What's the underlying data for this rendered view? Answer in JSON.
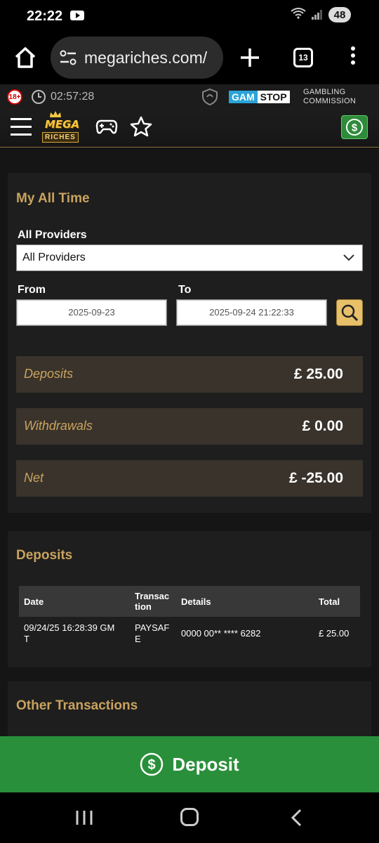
{
  "status_bar": {
    "time": "22:22",
    "battery": "48"
  },
  "browser": {
    "url": "megariches.com/",
    "tab_count": "13"
  },
  "compliance": {
    "age_badge": "18+",
    "session_time": "02:57:28",
    "gamstop_left": "GAM",
    "gamstop_right": "STOP",
    "gambling_commission_line1": "GAMBLING",
    "gambling_commission_line2": "COMMISSION"
  },
  "logo": {
    "line1": "MEGA",
    "line2": "RICHES"
  },
  "summary_panel": {
    "title": "My All Time",
    "providers_label": "All Providers",
    "providers_selected": "All Providers",
    "from_label": "From",
    "to_label": "To",
    "from_value": "2025-09-23",
    "to_value": "2025-09-24 21:22:33",
    "rows": [
      {
        "label": "Deposits",
        "value": "£ 25.00"
      },
      {
        "label": "Withdrawals",
        "value": "£ 0.00"
      },
      {
        "label": "Net",
        "value": "£ -25.00"
      }
    ]
  },
  "deposits_panel": {
    "title": "Deposits",
    "columns": {
      "date": "Date",
      "transaction_line1": "Transac",
      "transaction_line2": "tion",
      "details": "Details",
      "total": "Total"
    },
    "rows": [
      {
        "date_line1": "09/24/25 16:28:39 GM",
        "date_line2": "T",
        "transaction_line1": "PAYSAF",
        "transaction_line2": "E",
        "details": "0000 00** **** 6282",
        "total": "£ 25.00"
      }
    ]
  },
  "other_panel": {
    "title": "Other Transactions"
  },
  "deposit_button": {
    "label": "Deposit"
  },
  "colors": {
    "accent_gold": "#c9a35e",
    "deposit_green": "#2a8f3a",
    "row_bg": "#39332b"
  },
  "icons": [
    "youtube-icon",
    "wifi-icon",
    "signal-icon",
    "home-icon",
    "site-settings-icon",
    "plus-icon",
    "more-icon",
    "clock-icon",
    "shield-icon",
    "hamburger-icon",
    "gamepad-icon",
    "star-icon",
    "cash-icon",
    "chevron-down-icon",
    "search-icon",
    "dollar-circle-icon",
    "recents-icon",
    "back-icon"
  ]
}
